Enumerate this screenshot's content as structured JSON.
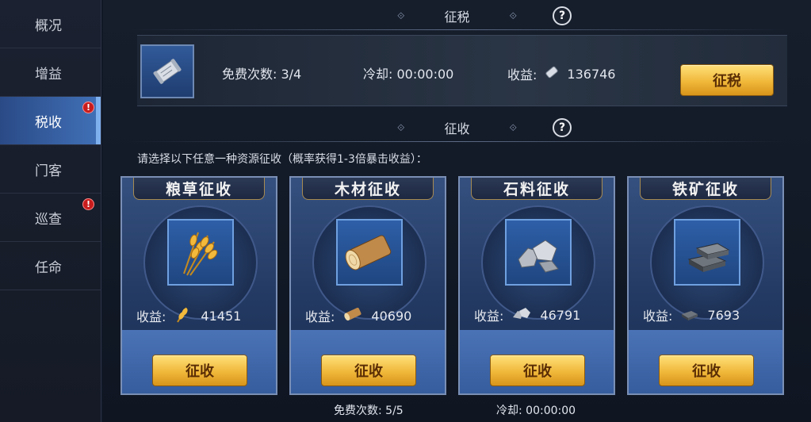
{
  "sidebar": {
    "items": [
      {
        "label": "概况",
        "badge": ""
      },
      {
        "label": "增益",
        "badge": ""
      },
      {
        "label": "税收",
        "badge": "!"
      },
      {
        "label": "门客",
        "badge": ""
      },
      {
        "label": "巡查",
        "badge": "!"
      },
      {
        "label": "任命",
        "badge": ""
      }
    ],
    "active_index": 2
  },
  "tax": {
    "title": "征税",
    "help": "?",
    "free_times": "免费次数: 3/4",
    "cooldown": "冷却: 00:00:00",
    "income_label": "收益:",
    "income_value": "136746",
    "button": "征税"
  },
  "collect": {
    "title": "征收",
    "help": "?",
    "prompt": "请选择以下任意一种资源征收（概率获得1-3倍暴击收益）：",
    "cards": [
      {
        "title": "粮草征收",
        "yield_label": "收益:",
        "yield_value": "41451",
        "button": "征收",
        "icon": "wheat-icon"
      },
      {
        "title": "木材征收",
        "yield_label": "收益:",
        "yield_value": "40690",
        "button": "征收",
        "icon": "log-icon"
      },
      {
        "title": "石料征收",
        "yield_label": "收益:",
        "yield_value": "46791",
        "button": "征收",
        "icon": "stone-icon"
      },
      {
        "title": "铁矿征收",
        "yield_label": "收益:",
        "yield_value": "7693",
        "button": "征收",
        "icon": "iron-ingot-icon"
      }
    ],
    "free_times": "免费次数: 5/5",
    "cooldown": "冷却: 00:00:00"
  },
  "colors": {
    "accent": "#f0b83a",
    "active_tab": "#4171b8",
    "badge": "#c81c1c"
  }
}
